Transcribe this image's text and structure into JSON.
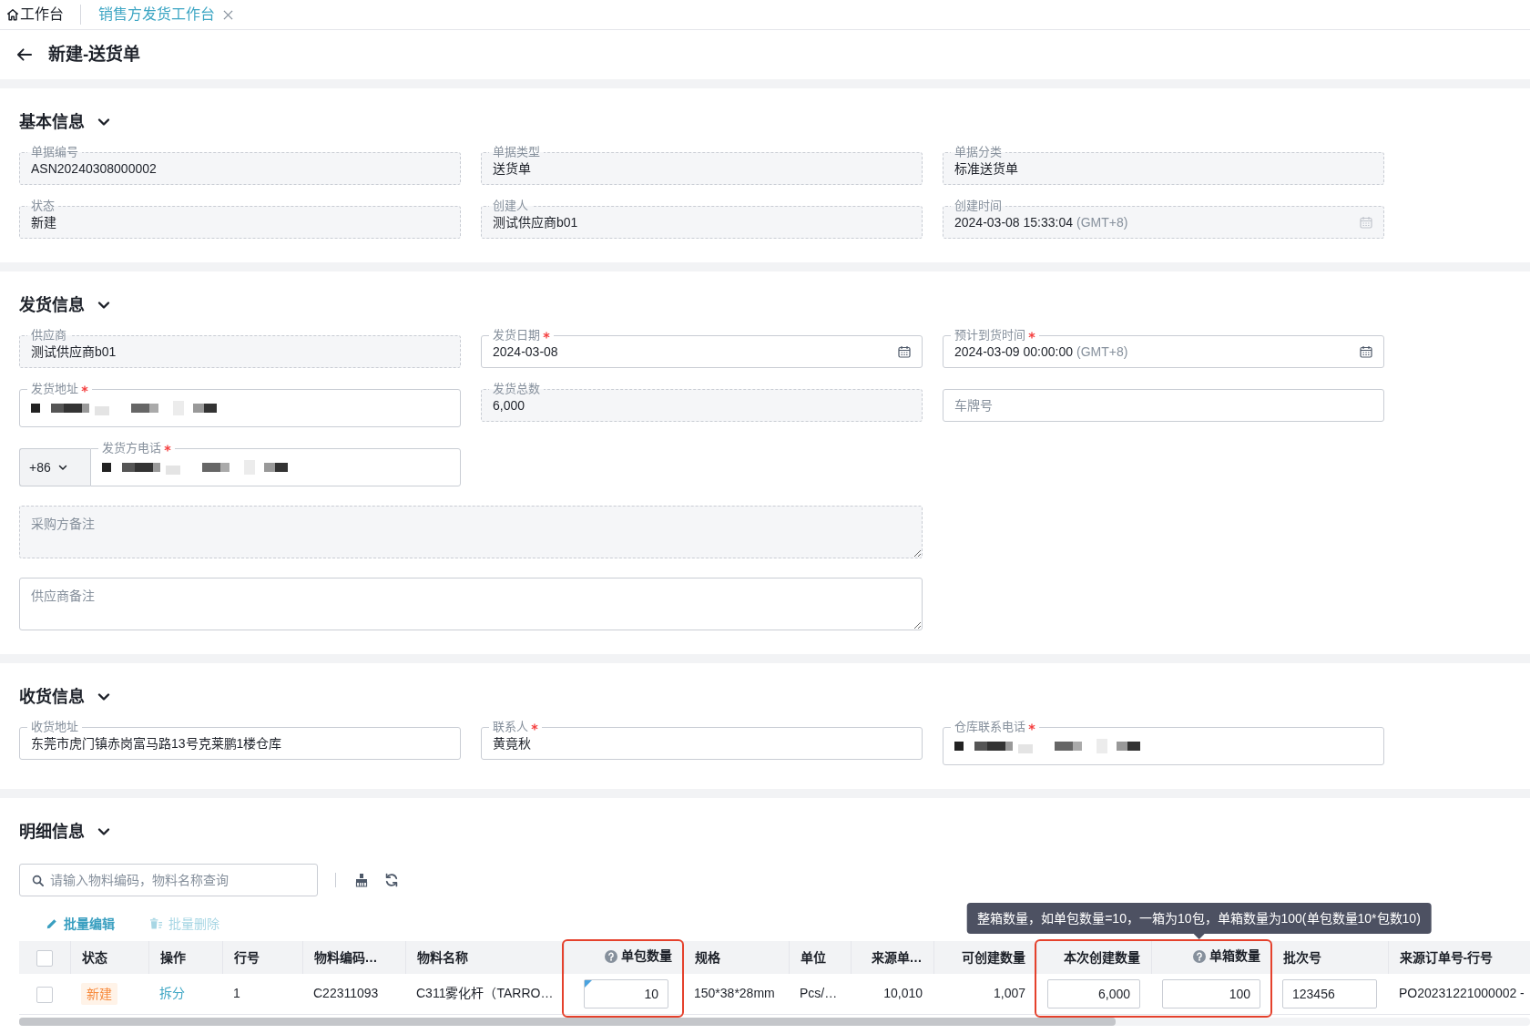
{
  "tabs": [
    {
      "kind": "home",
      "label": "工作台",
      "selected": false,
      "closable": false
    },
    {
      "kind": "page",
      "label": "销售方发货工作台",
      "selected": true,
      "closable": true
    }
  ],
  "header": {
    "title": "新建-送货单"
  },
  "sections": [
    {
      "title": "基本信息",
      "expanded": true,
      "fields": [
        {
          "kind": "text",
          "label": "单据编号",
          "value": "ASN20240308000002",
          "readonly": true,
          "required": false
        },
        {
          "kind": "text",
          "label": "单据类型",
          "value": "送货单",
          "readonly": true,
          "required": false
        },
        {
          "kind": "text",
          "label": "单据分类",
          "value": "标准送货单",
          "readonly": true,
          "required": false
        },
        {
          "kind": "text",
          "label": "状态",
          "value": "新建",
          "readonly": true,
          "required": false
        },
        {
          "kind": "text",
          "label": "创建人",
          "value": "测试供应商b01",
          "readonly": true,
          "required": false
        },
        {
          "kind": "date",
          "label": "创建时间",
          "value": "2024-03-08 15:33:04",
          "suffix": "(GMT+8)",
          "readonly": true,
          "required": false
        }
      ]
    },
    {
      "title": "发货信息",
      "expanded": true,
      "fields": [
        {
          "kind": "text",
          "label": "供应商",
          "value": "测试供应商b01",
          "readonly": true,
          "required": false
        },
        {
          "kind": "date",
          "label": "发货日期",
          "value": "2024-03-08",
          "readonly": false,
          "required": true
        },
        {
          "kind": "date",
          "label": "预计到货时间",
          "value": "2024-03-09 00:00:00",
          "suffix": "(GMT+8)",
          "readonly": false,
          "required": true
        },
        {
          "kind": "text",
          "label": "发货地址",
          "redacted": true,
          "readonly": false,
          "required": true
        },
        {
          "kind": "text",
          "label": "发货总数",
          "value": "6,000",
          "readonly": true,
          "required": false
        },
        {
          "kind": "text",
          "placeholder": "车牌号",
          "readonly": false
        },
        {
          "kind": "phone",
          "label": "发货方电话",
          "country_code": "+86",
          "redacted": true,
          "readonly": false,
          "required": true
        },
        {
          "kind": "textarea",
          "placeholder": "采购方备注",
          "readonly": true
        },
        {
          "kind": "textarea",
          "placeholder": "供应商备注",
          "readonly": false
        }
      ]
    },
    {
      "title": "收货信息",
      "expanded": true,
      "fields": [
        {
          "kind": "text",
          "label": "收货地址",
          "value": "东莞市虎门镇赤岗富马路13号克莱鹏1楼仓库",
          "readonly": false,
          "required": false
        },
        {
          "kind": "text",
          "label": "联系人",
          "value": "黄竟秋",
          "readonly": false,
          "required": true
        },
        {
          "kind": "text",
          "label": "仓库联系电话",
          "redacted": true,
          "readonly": false,
          "required": true
        }
      ]
    },
    {
      "title": "明细信息",
      "expanded": true,
      "search": {
        "placeholder": "请输入物料编码，物料名称查询"
      },
      "actions": [
        {
          "kind": "edit",
          "label": "批量编辑",
          "disabled": false
        },
        {
          "kind": "delete",
          "label": "批量删除",
          "disabled": true
        }
      ],
      "table": {
        "select_all_checked": false,
        "columns": [
          {
            "label": "状态",
            "kind": "text",
            "help": false,
            "highlighted": false
          },
          {
            "label": "操作",
            "kind": "text",
            "help": false,
            "highlighted": false
          },
          {
            "label": "行号",
            "kind": "text",
            "help": false,
            "highlighted": false
          },
          {
            "label": "物料编码…",
            "kind": "text",
            "help": false,
            "highlighted": false
          },
          {
            "label": "物料名称",
            "kind": "text",
            "help": false,
            "highlighted": false
          },
          {
            "label": "单包数量",
            "kind": "number",
            "help": true,
            "highlighted": true
          },
          {
            "label": "规格",
            "kind": "text",
            "help": false,
            "highlighted": false
          },
          {
            "label": "单位",
            "kind": "text",
            "help": false,
            "highlighted": false
          },
          {
            "label": "来源单…",
            "kind": "number",
            "help": false,
            "highlighted": false
          },
          {
            "label": "可创建数量",
            "kind": "number",
            "help": false,
            "highlighted": false
          },
          {
            "label": "本次创建数量",
            "kind": "number",
            "help": false,
            "highlighted": true
          },
          {
            "label": "单箱数量",
            "kind": "number",
            "help": true,
            "highlighted": true,
            "tooltip": "整箱数量，如单包数量=10，一箱为10包，单箱数量为100(单包数量10*包数10)"
          },
          {
            "label": "批次号",
            "kind": "text",
            "help": false,
            "highlighted": false
          },
          {
            "label": "来源订单号-行号",
            "kind": "text",
            "help": false,
            "highlighted": false
          }
        ],
        "rows": [
          {
            "checked": false,
            "cells": [
              {
                "kind": "badge",
                "text": "新建"
              },
              {
                "kind": "link",
                "text": "拆分"
              },
              {
                "kind": "text",
                "text": "1"
              },
              {
                "kind": "text",
                "text": "C22311093"
              },
              {
                "kind": "text",
                "text": "C311雾化杆（TARRO…"
              },
              {
                "kind": "input",
                "value": "10",
                "modified": true
              },
              {
                "kind": "text",
                "text": "150*38*28mm"
              },
              {
                "kind": "text",
                "text": "Pcs/…"
              },
              {
                "kind": "text",
                "text": "10,010"
              },
              {
                "kind": "text",
                "text": "1,007"
              },
              {
                "kind": "input",
                "value": "6,000",
                "modified": false
              },
              {
                "kind": "input",
                "value": "100",
                "modified": false
              },
              {
                "kind": "input",
                "value": "123456",
                "modified": false
              },
              {
                "kind": "text",
                "text": "PO20231221000002 -"
              }
            ]
          }
        ]
      }
    }
  ]
}
